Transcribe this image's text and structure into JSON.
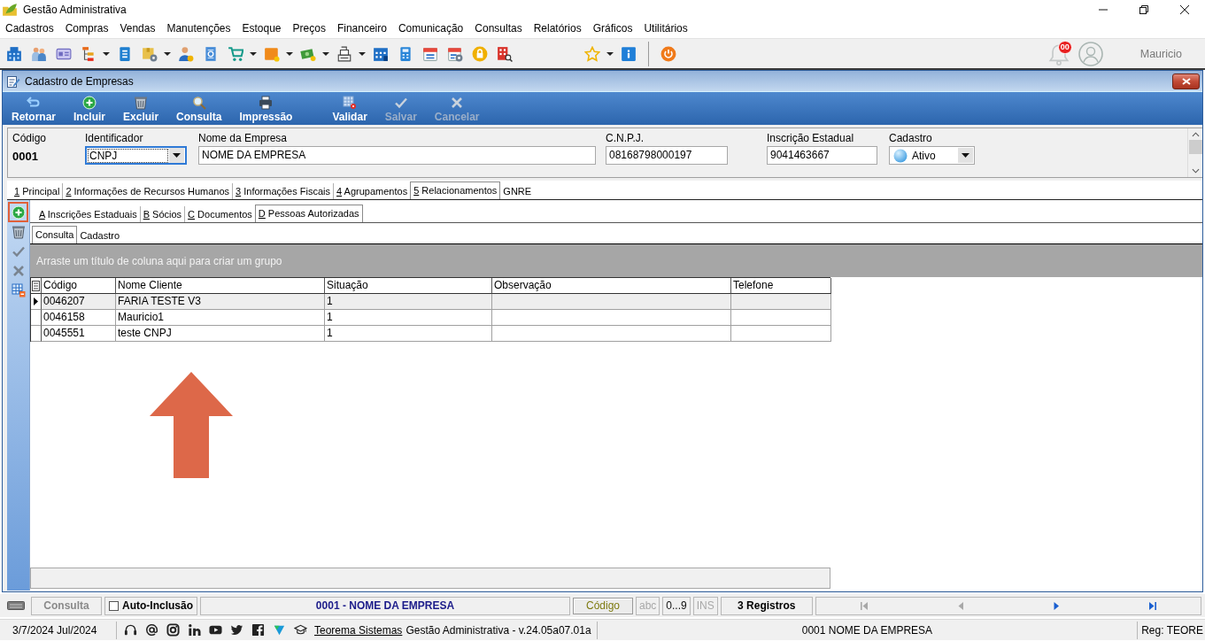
{
  "app": {
    "title": "Gestão Administrativa"
  },
  "menu": [
    "Cadastros",
    "Compras",
    "Vendas",
    "Manutenções",
    "Estoque",
    "Preços",
    "Financeiro",
    "Comunicação",
    "Consultas",
    "Relatórios",
    "Gráficos",
    "Utilitários"
  ],
  "toolbar": {
    "notifications": "00",
    "user": "Mauricio"
  },
  "window": {
    "title": "Cadastro de Empresas",
    "actions": [
      {
        "label": "Retornar",
        "disabled": false
      },
      {
        "label": "Incluir",
        "disabled": false
      },
      {
        "label": "Excluir",
        "disabled": false
      },
      {
        "label": "Consulta",
        "disabled": false
      },
      {
        "label": "Impressão",
        "disabled": false
      },
      {
        "label": "Validar",
        "disabled": false
      },
      {
        "label": "Salvar",
        "disabled": true
      },
      {
        "label": "Cancelar",
        "disabled": true
      }
    ],
    "fields": [
      {
        "kind": "static",
        "label": "Código",
        "value": "0001"
      },
      {
        "kind": "select",
        "label": "Identificador",
        "value": "CNPJ",
        "focused": true
      },
      {
        "kind": "text",
        "label": "Nome da Empresa",
        "value": "NOME DA EMPRESA"
      },
      {
        "kind": "text",
        "label": "C.N.P.J.",
        "value": "08168798000197"
      },
      {
        "kind": "text",
        "label": "Inscrição Estadual",
        "value": "9041463667"
      },
      {
        "kind": "status-select",
        "label": "Cadastro",
        "value": "Ativo"
      }
    ],
    "tabs": [
      {
        "key": "1",
        "label": "Principal",
        "selected": false
      },
      {
        "key": "2",
        "label": "Informações de Recursos Humanos",
        "selected": false
      },
      {
        "key": "3",
        "label": "Informações Fiscais",
        "selected": false
      },
      {
        "key": "4",
        "label": "Agrupamentos",
        "selected": false
      },
      {
        "key": "5",
        "label": "Relacionamentos",
        "selected": true
      },
      {
        "label": "GNRE",
        "selected": false
      }
    ],
    "side_tools": [
      {
        "highlighted": true,
        "disabled": false
      },
      {
        "highlighted": false,
        "disabled": false
      },
      {
        "highlighted": false,
        "disabled": true
      },
      {
        "highlighted": false,
        "disabled": true
      },
      {
        "highlighted": false,
        "disabled": false
      }
    ],
    "subtabs": [
      {
        "key": "A",
        "label": "Inscrições Estaduais",
        "selected": false
      },
      {
        "key": "B",
        "label": "Sócios",
        "selected": false
      },
      {
        "key": "C",
        "label": "Documentos",
        "selected": false
      },
      {
        "key": "D",
        "label": "Pessoas Autorizadas",
        "selected": true
      }
    ],
    "view_tabs": [
      {
        "label": "Consulta",
        "selected": true
      },
      {
        "label": "Cadastro",
        "selected": false
      }
    ],
    "group_panel": {
      "hint": "Arraste um título de coluna aqui para criar um grupo"
    },
    "table": {
      "columns": [
        "Código",
        "Nome Cliente",
        "Situação",
        "Observação",
        "Telefone"
      ],
      "rows": [
        {
          "cells": [
            "0046207",
            "FARIA TESTE V3",
            "1"
          ],
          "current": true
        },
        {
          "cells": [
            "0046158",
            "Mauricio1",
            "1"
          ],
          "current": false
        },
        {
          "cells": [
            "0045551",
            "teste CNPJ",
            "1"
          ],
          "current": false
        }
      ]
    },
    "annotations": [
      {
        "kind": "arrow-up"
      }
    ]
  },
  "status_bar": {
    "mode": "Consulta",
    "auto_inclusion": {
      "label": "Auto-Inclusão",
      "checked": false
    },
    "record": "0001 - NOME DA EMPRESA",
    "search_key": "Código",
    "indicators": [
      {
        "label": "abc",
        "active": false
      },
      {
        "label": "0...9",
        "active": true
      },
      {
        "label": "INS",
        "active": false
      }
    ],
    "count": "3 Registros",
    "navigation": [
      {
        "kind": "first",
        "disabled": true
      },
      {
        "kind": "previous",
        "disabled": true
      },
      {
        "kind": "next",
        "disabled": false
      },
      {
        "kind": "last",
        "disabled": false
      }
    ]
  },
  "footer": {
    "date": "3/7/2024 Jul/2024",
    "link": "Teorema Sistemas",
    "version": "Gestão Administrativa - v.24.05a07.01a",
    "company": "0001 NOME DA EMPRESA",
    "registration": "Reg: TEORE"
  }
}
